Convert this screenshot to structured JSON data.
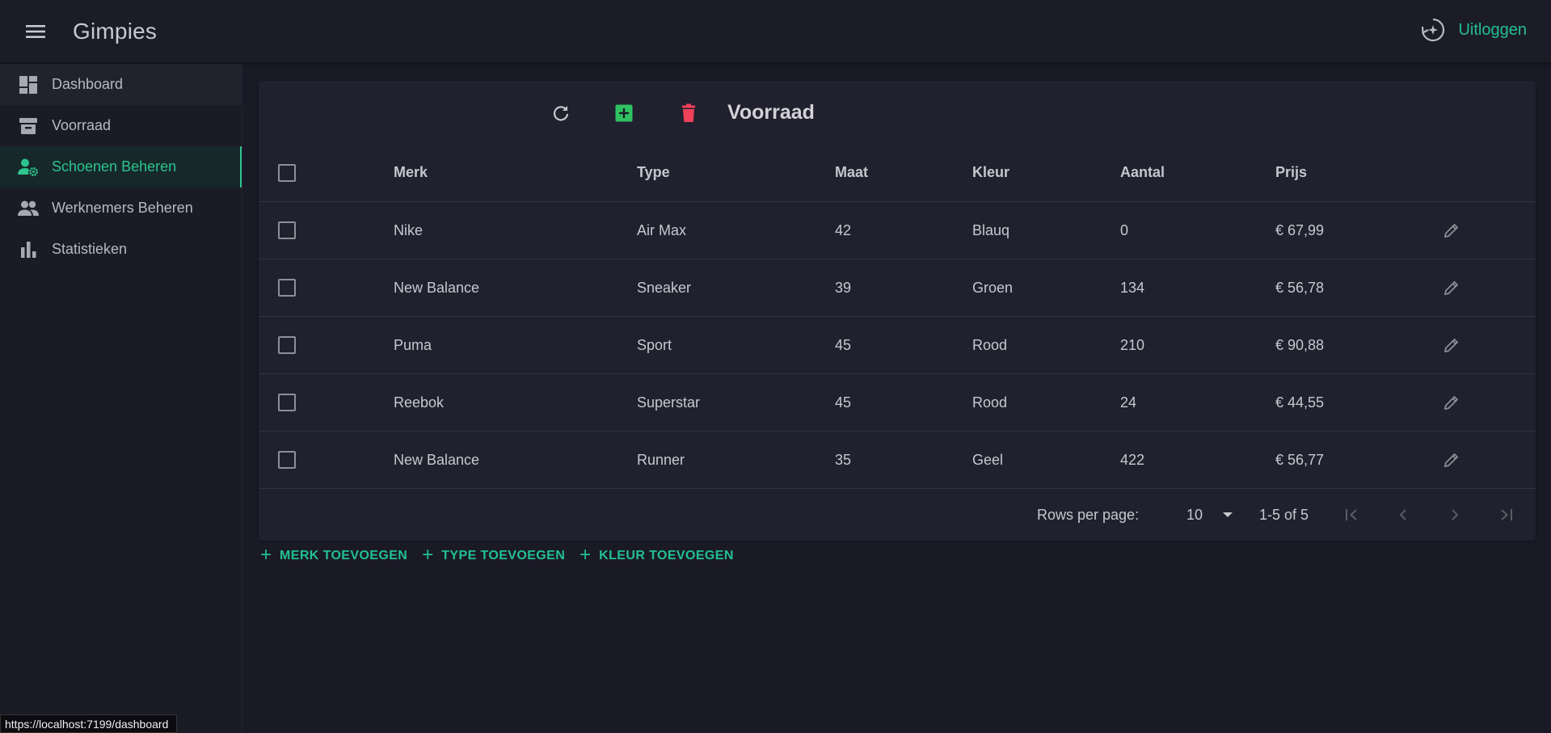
{
  "appbar": {
    "title": "Gimpies",
    "logout_label": "Uitloggen"
  },
  "sidebar": {
    "items": [
      {
        "label": "Dashboard",
        "icon": "dashboard-icon"
      },
      {
        "label": "Voorraad",
        "icon": "archive-icon"
      },
      {
        "label": "Schoenen Beheren",
        "icon": "user-cog-icon",
        "active": true
      },
      {
        "label": "Werknemers Beheren",
        "icon": "people-icon"
      },
      {
        "label": "Statistieken",
        "icon": "bar-chart-icon"
      }
    ]
  },
  "card": {
    "title": "Voorraad",
    "toolbar": {
      "refresh_icon": "refresh-icon",
      "add_icon": "add-box-icon",
      "delete_icon": "trash-icon"
    }
  },
  "table": {
    "columns": [
      "Merk",
      "Type",
      "Maat",
      "Kleur",
      "Aantal",
      "Prijs"
    ],
    "rows": [
      {
        "merk": "Nike",
        "type": "Air Max",
        "maat": "42",
        "kleur": "Blauq",
        "aantal": "0",
        "prijs": "€ 67,99"
      },
      {
        "merk": "New Balance",
        "type": "Sneaker",
        "maat": "39",
        "kleur": "Groen",
        "aantal": "134",
        "prijs": "€ 56,78"
      },
      {
        "merk": "Puma",
        "type": "Sport",
        "maat": "45",
        "kleur": "Rood",
        "aantal": "210",
        "prijs": "€ 90,88"
      },
      {
        "merk": "Reebok",
        "type": "Superstar",
        "maat": "45",
        "kleur": "Rood",
        "aantal": "24",
        "prijs": "€ 44,55"
      },
      {
        "merk": "New Balance",
        "type": "Runner",
        "maat": "35",
        "kleur": "Geel",
        "aantal": "422",
        "prijs": "€ 56,77"
      }
    ]
  },
  "pagination": {
    "rows_per_page_label": "Rows per page:",
    "rows_per_page_value": "10",
    "range_label": "1-5 of 5"
  },
  "actions": {
    "add_merk": "MERK TOEVOEGEN",
    "add_type": "TYPE TOEVOEGEN",
    "add_kleur": "KLEUR TOEVOEGEN"
  },
  "status_bar": {
    "url": "https://localhost:7199/dashboard"
  },
  "colors": {
    "accent": "#22c08f",
    "add": "#2fc262",
    "delete": "#f0405a",
    "background": "#1a1a27",
    "surface": "#20202e"
  }
}
